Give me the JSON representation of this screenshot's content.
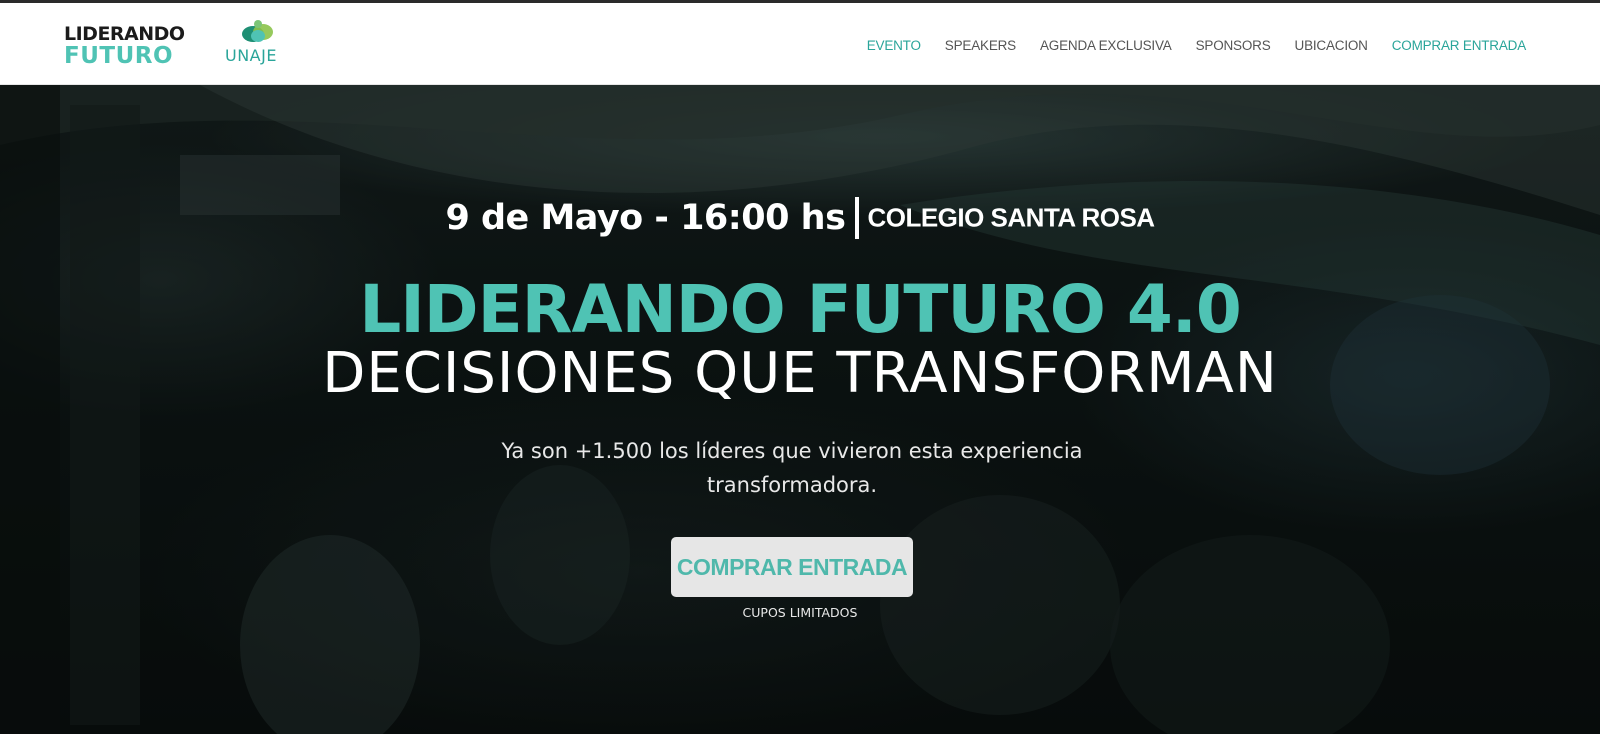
{
  "colors": {
    "accent": "#4fc3b4",
    "accent_dark": "#2aa59a",
    "header_bg": "#ffffff",
    "cta_bg": "#e6e6e6",
    "hero_overlay": "#0a100f"
  },
  "header": {
    "logo": {
      "line1": "LIDERANDO",
      "line2": "FUTURO"
    },
    "partner_logo": {
      "text": "UNAJE",
      "icon": "unaje-leaf-icon"
    },
    "nav": [
      {
        "label": "EVENTO",
        "accent": true
      },
      {
        "label": "SPEAKERS",
        "accent": false
      },
      {
        "label": "AGENDA EXCLUSIVA",
        "accent": false
      },
      {
        "label": "SPONSORS",
        "accent": false
      },
      {
        "label": "UBICACION",
        "accent": false
      },
      {
        "label": "COMPRAR ENTRADA",
        "accent": true
      }
    ]
  },
  "hero": {
    "date_time": "9 de Mayo - 16:00 hs",
    "venue": "COLEGIO SANTA ROSA",
    "title": "LIDERANDO FUTURO 4.0",
    "subtitle": "DECISIONES QUE TRANSFORMAN",
    "tagline": "Ya son +1.500 los líderes que vivieron esta experiencia transformadora.",
    "cta_label": "COMPRAR ENTRADA",
    "cta_note": "CUPOS LIMITADOS"
  }
}
